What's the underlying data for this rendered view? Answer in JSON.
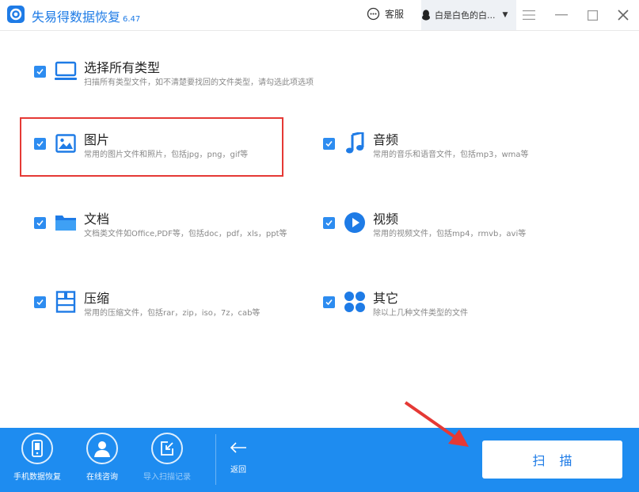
{
  "app": {
    "title": "失易得数据恢复",
    "version": "6.47"
  },
  "titlebar": {
    "service_label": "客服",
    "user_name": "白是白色的白..."
  },
  "options": [
    {
      "title": "选择所有类型",
      "desc": "扫描所有类型文件，如不清楚要找回的文件类型，请勾选此项选项",
      "checked": true,
      "icon": "monitor-icon"
    },
    {
      "title": "图片",
      "desc": "常用的图片文件和照片，包括jpg，png，gif等",
      "checked": true,
      "icon": "image-icon"
    },
    {
      "title": "音频",
      "desc": "常用的音乐和语音文件，包括mp3，wma等",
      "checked": true,
      "icon": "music-icon"
    },
    {
      "title": "文档",
      "desc": "文档类文件如Office,PDF等，包括doc，pdf，xls，ppt等",
      "checked": true,
      "icon": "folder-icon"
    },
    {
      "title": "视频",
      "desc": "常用的视频文件，包括mp4，rmvb，avi等",
      "checked": true,
      "icon": "play-icon"
    },
    {
      "title": "压缩",
      "desc": "常用的压缩文件，包括rar，zip，iso，7z，cab等",
      "checked": true,
      "icon": "archive-icon"
    },
    {
      "title": "其它",
      "desc": "除以上几种文件类型的文件",
      "checked": true,
      "icon": "dots-icon"
    }
  ],
  "bottombar": {
    "phone_recovery": "手机数据恢复",
    "online_consult": "在线咨询",
    "import_scan_record": "导入扫描记录",
    "back": "返回",
    "scan": "扫描"
  },
  "colors": {
    "accent": "#1e7be6",
    "bar": "#1e8cf0",
    "highlight": "#e53935"
  }
}
